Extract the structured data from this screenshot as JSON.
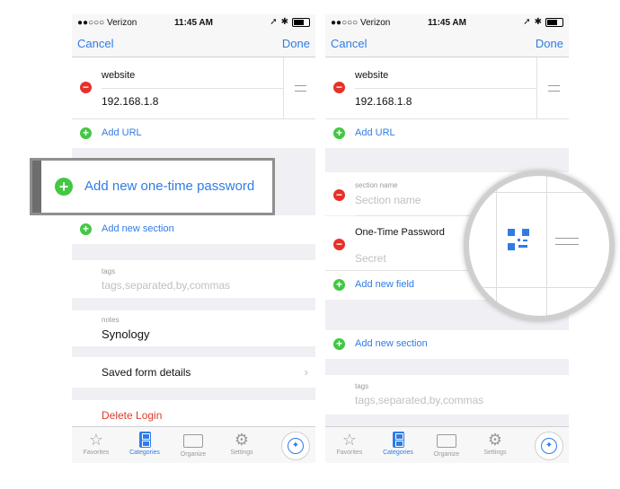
{
  "colors": {
    "accent": "#2f7ce6",
    "delete": "#e8302b",
    "add": "#42c842"
  },
  "left": {
    "status": {
      "carrier": "●●○○○ Verizon",
      "time": "11:45 AM"
    },
    "nav": {
      "cancel": "Cancel",
      "done": "Done"
    },
    "website_label": "website",
    "website_value": "192.168.1.8",
    "add_url": "Add URL",
    "add_section": "Add new section",
    "tags_label": "tags",
    "tags_placeholder": "tags,separated,by,commas",
    "notes_label": "notes",
    "notes_value": "Synology",
    "saved_form": "Saved form details",
    "delete_login": "Delete Login"
  },
  "callout": {
    "label": "Add new one-time password"
  },
  "right": {
    "status": {
      "carrier": "●●○○○ Verizon",
      "time": "11:45 AM"
    },
    "nav": {
      "cancel": "Cancel",
      "done": "Done"
    },
    "website_label": "website",
    "website_value": "192.168.1.8",
    "add_url": "Add URL",
    "section_name_label": "section name",
    "section_name_placeholder": "Section name",
    "otp_label": "One-Time Password",
    "otp_placeholder": "Secret",
    "add_field": "Add new field",
    "add_section": "Add new section",
    "tags_label": "tags",
    "tags_placeholder": "tags,separated,by,commas"
  },
  "tabs": [
    "Favorites",
    "Categories",
    "Organize",
    "Settings"
  ],
  "icons": {
    "star": "☆",
    "gear": "⚙",
    "chevron": "›",
    "plus": "+",
    "minus": "−",
    "bluetooth": "✱",
    "location": "➚"
  }
}
